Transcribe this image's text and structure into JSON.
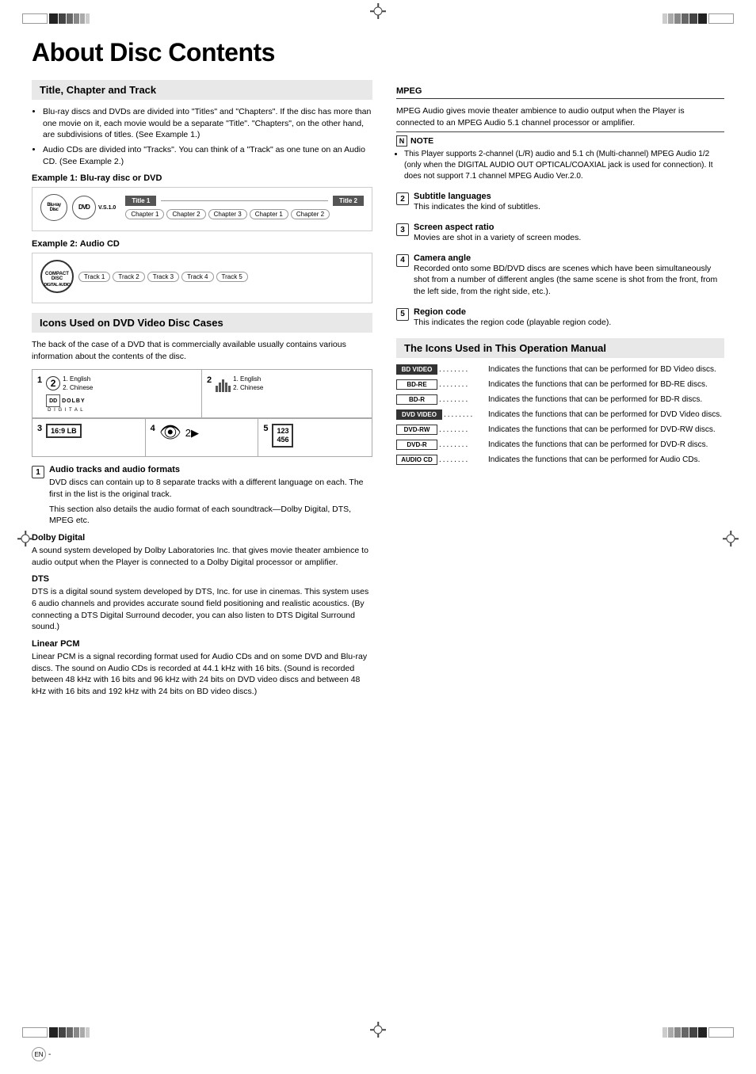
{
  "page": {
    "title": "About Disc Contents",
    "footer_badge": "EN",
    "footer_dash": "-"
  },
  "left_col": {
    "section1": {
      "title": "Title, Chapter and Track",
      "bullets": [
        "Blu-ray discs and DVDs are divided into \"Titles\" and \"Chapters\". If the disc has more than one movie on it, each movie would be a separate \"Title\". \"Chapters\", on the other hand, are subdivisions of titles. (See Example 1.)",
        "Audio CDs are divided into \"Tracks\". You can think of a \"Track\" as one tune on an Audio CD. (See Example 2.)"
      ]
    },
    "example1": {
      "label": "Example 1: Blu-ray disc or DVD",
      "titles": [
        "Title 1",
        "Title 2"
      ],
      "chapters": [
        "Chapter 1",
        "Chapter 2",
        "Chapter 3",
        "Chapter 1",
        "Chapter 2"
      ]
    },
    "example2": {
      "label": "Example 2: Audio CD",
      "tracks": [
        "Track 1",
        "Track 2",
        "Track 3",
        "Track 4",
        "Track 5"
      ]
    },
    "section2": {
      "title": "Icons Used on DVD Video Disc Cases",
      "body": "The back of the case of a DVD that is commercially available usually contains various information about the contents of the disc."
    },
    "icon_cells": {
      "cell1": {
        "number": "1",
        "num_circle": "2",
        "lines": [
          "1. English",
          "2. Chinese"
        ],
        "audio_format1": "DIGITAL",
        "audio_dolby": "DOLBY",
        "audio_format2": "D I G I T A L"
      },
      "cell2": {
        "number": "2",
        "lines": [
          "1. English",
          "2. Chinese"
        ]
      },
      "cell3": {
        "number": "3",
        "ratio": "16:9 LB"
      },
      "cell4": {
        "number": "4"
      },
      "cell5": {
        "number": "5",
        "numbers": "123\n456"
      }
    },
    "numbered_items": [
      {
        "num": "1",
        "title": "Audio tracks and audio formats",
        "body": "DVD discs can contain up to 8 separate tracks with a different language on each. The first in the list is the original track.\nThis section also details the audio format of each soundtrack—Dolby Digital, DTS, MPEG etc."
      }
    ],
    "dolby_digital": {
      "title": "Dolby Digital",
      "body": "A sound system developed by Dolby Laboratories Inc. that gives movie theater ambience to audio output when the Player is connected to a Dolby Digital processor or amplifier."
    },
    "dts": {
      "title": "DTS",
      "body": "DTS is a digital sound system developed by DTS, Inc. for use in cinemas. This system uses 6 audio channels and provides accurate sound field positioning and realistic acoustics. (By connecting a DTS Digital Surround decoder, you can also listen to DTS Digital Surround sound.)"
    },
    "linear_pcm": {
      "title": "Linear PCM",
      "body": "Linear PCM is a signal recording format used for Audio CDs and on some DVD and Blu-ray discs. The sound on Audio CDs is recorded at 44.1 kHz with 16 bits. (Sound is recorded between 48 kHz with 16 bits and 96 kHz with 24 bits on DVD video discs and between 48 kHz with 16 bits and 192 kHz with 24 bits on BD video discs.)"
    }
  },
  "right_col": {
    "mpeg": {
      "title": "MPEG",
      "body": "MPEG Audio gives movie theater ambience to audio output when the Player is connected to an MPEG Audio 5.1 channel processor or amplifier."
    },
    "note": {
      "bullet": "This Player supports 2-channel (L/R) audio and 5.1 ch (Multi-channel) MPEG Audio 1/2 (only when the DIGITAL AUDIO OUT OPTICAL/COAXIAL jack is used for connection). It does not support 7.1 channel MPEG Audio Ver.2.0."
    },
    "subtitle": {
      "num": "2",
      "title": "Subtitle languages",
      "body": "This indicates the kind of subtitles."
    },
    "screen_aspect": {
      "num": "3",
      "title": "Screen aspect ratio",
      "body": "Movies are shot in a variety of screen modes."
    },
    "camera_angle": {
      "num": "4",
      "title": "Camera angle",
      "body": "Recorded onto some BD/DVD discs are scenes which have been simultaneously shot from a number of different angles (the same scene is shot from the front, from the left side, from the right side, etc.)."
    },
    "region_code": {
      "num": "5",
      "title": "Region code",
      "body": "This indicates the region code (playable region code)."
    },
    "op_manual": {
      "title": "The Icons Used in This Operation Manual",
      "icons": [
        {
          "label": "BD VIDEO",
          "dots": "........",
          "desc": "Indicates the functions that can be performed for BD Video discs."
        },
        {
          "label": "BD-RE",
          "dots": "........",
          "desc": "Indicates the functions that can be performed for BD-RE discs."
        },
        {
          "label": "BD-R",
          "dots": "........",
          "desc": "Indicates the functions that can be performed for BD-R discs."
        },
        {
          "label": "DVD VIDEO",
          "dots": "........",
          "desc": "Indicates the functions that can be performed for DVD Video discs."
        },
        {
          "label": "DVD-RW",
          "dots": "........",
          "desc": "Indicates the functions that can be performed for DVD-RW discs."
        },
        {
          "label": "DVD-R",
          "dots": "........",
          "desc": "Indicates the functions that can be performed for DVD-R discs."
        },
        {
          "label": "AUDIO CD",
          "dots": "........",
          "desc": "Indicates the functions that can be performed for Audio CDs."
        }
      ]
    }
  }
}
